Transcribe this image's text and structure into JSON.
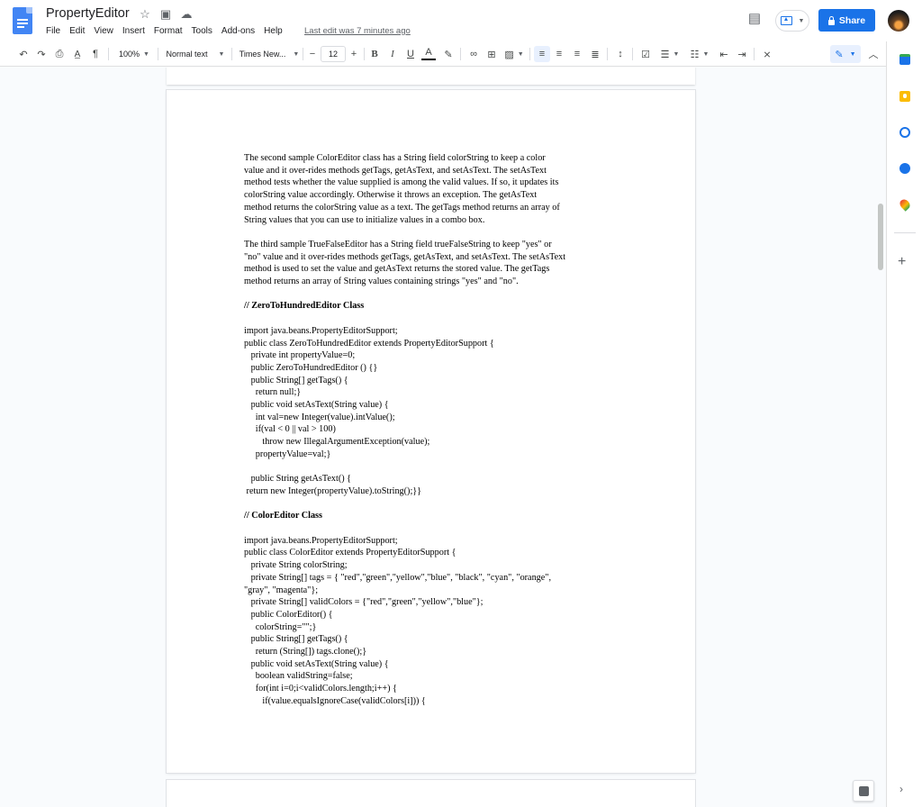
{
  "app": {
    "title": "PropertyEditor",
    "last_edit": "Last edit was 7 minutes ago",
    "menu": [
      "File",
      "Edit",
      "View",
      "Insert",
      "Format",
      "Tools",
      "Add-ons",
      "Help"
    ],
    "share_label": "Share"
  },
  "toolbar": {
    "zoom": "100%",
    "style": "Normal text",
    "font": "Times New...",
    "font_size": "12",
    "minus": "−",
    "plus": "+"
  },
  "document": {
    "paragraphs": [
      [
        "The second sample ColorEditor class has a String field colorString to keep a color",
        "value and it over-rides methods getTags, getAsText, and setAsText. The setAsText",
        "method tests whether the value supplied is among the valid values. If so, it updates its",
        "colorString value accordingly. Otherwise it throws an exception. The getAsText",
        "method returns the colorString value as a text. The getTags method returns an array of",
        "String values that you can use to initialize values in a combo box."
      ],
      [
        "The third sample TrueFalseEditor has a String field trueFalseString to keep \"yes\" or",
        "\"no\" value and it over-rides methods getTags, getAsText, and setAsText. The setAsText",
        "method is used to set the value and getAsText returns the stored value. The getTags",
        "method returns an array of String values containing strings \"yes\" and \"no\"."
      ]
    ],
    "heading1": "// ZeroToHundredEditor Class",
    "code1": [
      "import java.beans.PropertyEditorSupport;",
      "public class ZeroToHundredEditor extends PropertyEditorSupport {",
      "   private int propertyValue=0;",
      "   public ZeroToHundredEditor () {}",
      "   public String[] getTags() {",
      "     return null;}",
      "   public void setAsText(String value) {",
      "     int val=new Integer(value).intValue();",
      "     if(val < 0 || val > 100)",
      "        throw new IllegalArgumentException(value);",
      "     propertyValue=val;}",
      "",
      "   public String getAsText() {",
      " return new Integer(propertyValue).toString();}}"
    ],
    "heading2": "//  ColorEditor Class",
    "code2": [
      "import java.beans.PropertyEditorSupport;",
      "public class ColorEditor extends PropertyEditorSupport {",
      "   private String colorString;",
      "   private String[] tags = { \"red\",\"green\",\"yellow\",\"blue\", \"black\", \"cyan\", \"orange\",",
      "\"gray\", \"magenta\"};",
      "   private String[] validColors = {\"red\",\"green\",\"yellow\",\"blue\"};",
      "   public ColorEditor() {",
      "     colorString=\"\";}",
      "   public String[] getTags() {",
      "     return (String[]) tags.clone();}",
      "   public void setAsText(String value) {",
      "     boolean validString=false;",
      "     for(int i=0;i<validColors.length;i++) {",
      "        if(value.equalsIgnoreCase(validColors[i])) {"
    ]
  },
  "colors": {
    "accent": "#1a73e8",
    "doc_blue": "#4285f4"
  }
}
